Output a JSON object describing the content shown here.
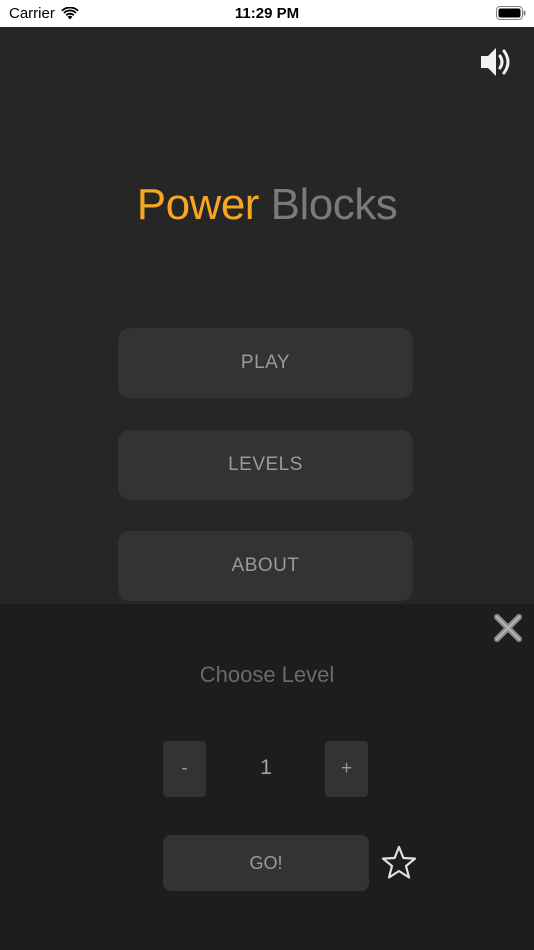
{
  "status_bar": {
    "carrier": "Carrier",
    "time": "11:29 PM",
    "icons": [
      "wifi-icon",
      "battery-icon"
    ]
  },
  "header": {
    "sound_icon": "speaker-icon"
  },
  "title": {
    "part1": "Power",
    "part2": "Blocks",
    "part1_color": "#f5a623",
    "part2_color": "#7a7a7a"
  },
  "menu": {
    "play_label": "PLAY",
    "levels_label": "LEVELS",
    "about_label": "ABOUT"
  },
  "level_panel": {
    "close_icon": "close-icon",
    "heading": "Choose Level",
    "decrement_label": "-",
    "value": "1",
    "increment_label": "+",
    "go_label": "GO!",
    "star_icon": "star-icon"
  },
  "colors": {
    "background": "#262626",
    "panel": "#1d1d1d",
    "button": "#333333",
    "accent": "#f5a623"
  }
}
